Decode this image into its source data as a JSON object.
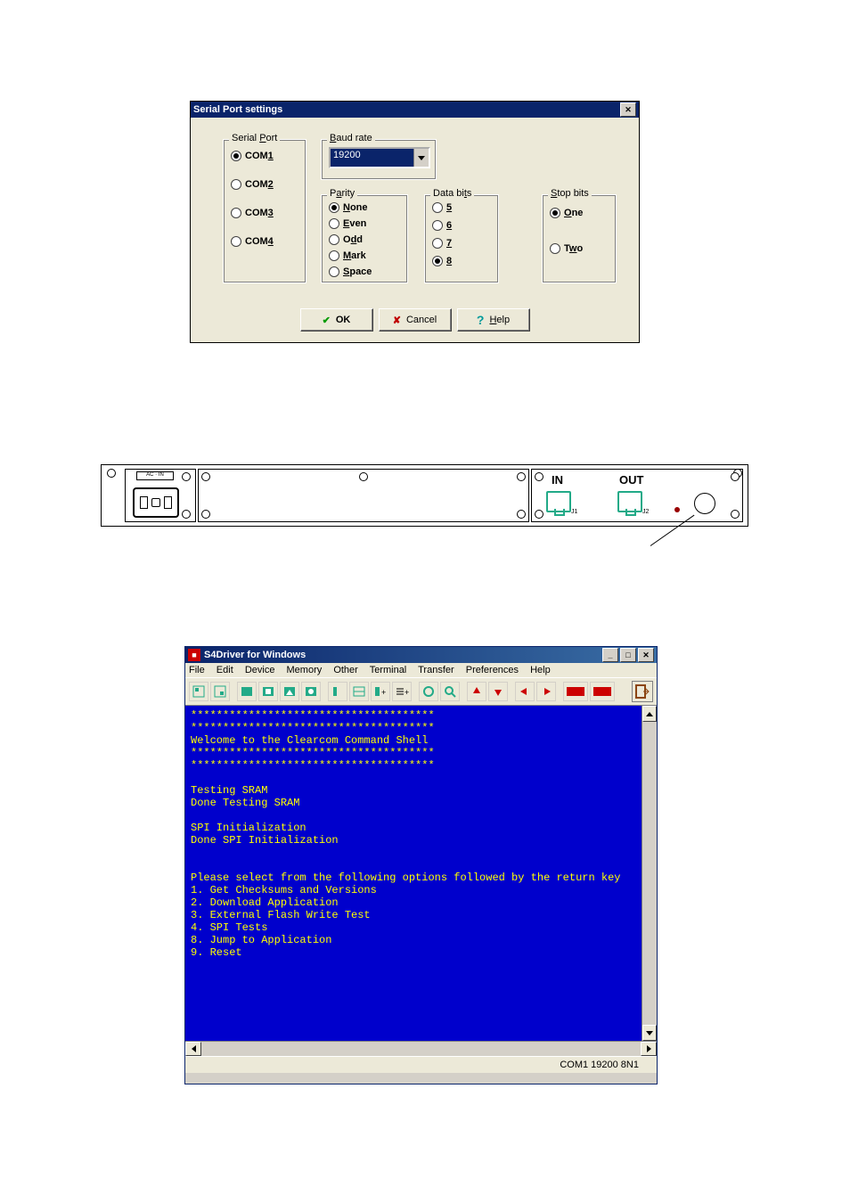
{
  "dialog1": {
    "title": "Serial Port settings",
    "groups": {
      "serial_port": {
        "legend": "Serial Port",
        "legend_u": "P",
        "options": [
          {
            "label": "COM1",
            "u": "1",
            "sel": true
          },
          {
            "label": "COM2",
            "u": "2",
            "sel": false
          },
          {
            "label": "COM3",
            "u": "3",
            "sel": false
          },
          {
            "label": "COM4",
            "u": "4",
            "sel": false
          }
        ]
      },
      "baud": {
        "legend": "Baud rate",
        "legend_u": "B",
        "value": "19200"
      },
      "parity": {
        "legend": "Parity",
        "legend_u": "a",
        "options": [
          {
            "label": "None",
            "u": "N",
            "sel": true
          },
          {
            "label": "Even",
            "u": "E",
            "sel": false
          },
          {
            "label": "Odd",
            "u": "d",
            "sel": false
          },
          {
            "label": "Mark",
            "u": "M",
            "sel": false
          },
          {
            "label": "Space",
            "u": "S",
            "sel": false
          }
        ]
      },
      "databits": {
        "legend": "Data bits",
        "legend_u": "t",
        "options": [
          {
            "label": "5",
            "u": "5",
            "sel": false
          },
          {
            "label": "6",
            "u": "6",
            "sel": false
          },
          {
            "label": "7",
            "u": "7",
            "sel": false
          },
          {
            "label": "8",
            "u": "8",
            "sel": true
          }
        ]
      },
      "stopbits": {
        "legend": "Stop bits",
        "legend_u": "S",
        "options": [
          {
            "label": "One",
            "u": "O",
            "sel": true
          },
          {
            "label": "Two",
            "u": "w",
            "sel": false
          }
        ]
      }
    },
    "buttons": {
      "ok": "OK",
      "cancel": "Cancel",
      "help": "Help",
      "help_u": "H"
    }
  },
  "panel": {
    "ac_label": "AC · IN",
    "in_label": "IN",
    "out_label": "OUT",
    "j1": "J1",
    "j2": "J2"
  },
  "terminal": {
    "title": "S4Driver for Windows",
    "menus": [
      "File",
      "Edit",
      "Device",
      "Memory",
      "Other",
      "Terminal",
      "Transfer",
      "Preferences",
      "Help"
    ],
    "status": "COM1 19200 8N1",
    "lines": [
      "**************************************",
      "**************************************",
      "Welcome to the Clearcom Command Shell",
      "**************************************",
      "**************************************",
      "",
      "Testing SRAM",
      "Done Testing SRAM",
      "",
      "SPI Initialization",
      "Done SPI Initialization",
      "",
      "",
      "Please select from the following options followed by the return key",
      "1. Get Checksums and Versions",
      "2. Download Application",
      "3. External Flash Write Test",
      "4. SPI Tests",
      "8. Jump to Application",
      "9. Reset",
      ""
    ]
  }
}
